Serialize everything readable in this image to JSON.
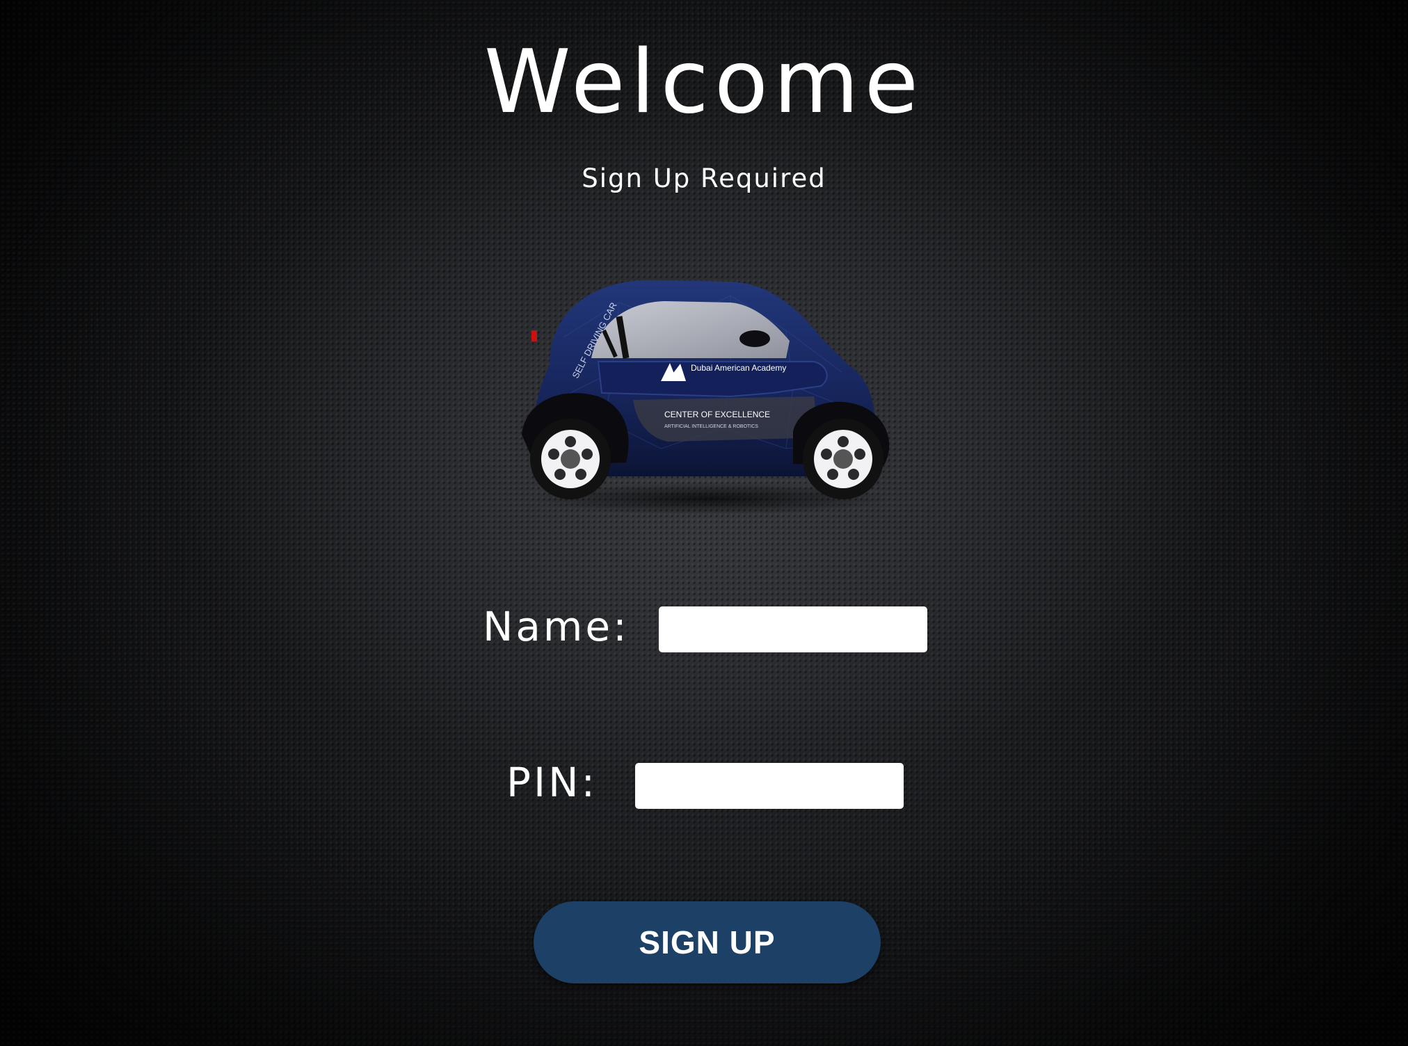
{
  "header": {
    "title": "Welcome",
    "subtitle": "Sign Up Required"
  },
  "car_image": {
    "decal_text_side": "SELF DRIVING CAR",
    "decal_logo_name": "Dubai American Academy",
    "decal_center": "CENTER OF EXCELLENCE",
    "decal_center_sub": "ARTIFICIAL INTELLIGENCE & ROBOTICS"
  },
  "form": {
    "name_label": "Name:",
    "name_value": "",
    "pin_label": "PIN:",
    "pin_value": ""
  },
  "actions": {
    "signup_label": "SIGN UP"
  },
  "colors": {
    "button": "#1d4066",
    "car_body": "#1a2a5c",
    "background": "#1a1b1e"
  }
}
